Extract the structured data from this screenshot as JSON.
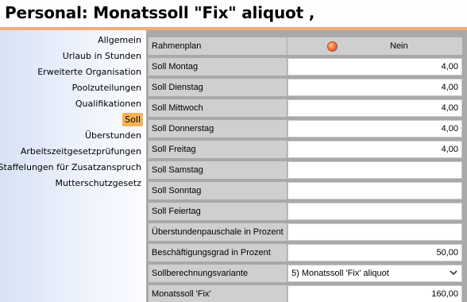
{
  "window": {
    "title": "Personal: Monatssoll \"Fix\" aliquot ,"
  },
  "sidebar": {
    "items": [
      {
        "label": "Allgemein",
        "active": false
      },
      {
        "label": "Urlaub in Stunden",
        "active": false
      },
      {
        "label": "Erweiterte Organisation",
        "active": false
      },
      {
        "label": "Poolzuteilungen",
        "active": false
      },
      {
        "label": "Qualifikationen",
        "active": false
      },
      {
        "label": "Soll",
        "active": true
      },
      {
        "label": "Überstunden",
        "active": false
      },
      {
        "label": "Arbeitszeitgesetzprüfungen",
        "active": false
      },
      {
        "label": "Staffelungen für Zusatzanspruch",
        "active": false
      },
      {
        "label": "Mutterschutzgesetz",
        "active": false
      }
    ]
  },
  "form": {
    "rahmenplan": {
      "label": "Rahmenplan",
      "status_icon": "red-status-dot-icon",
      "value": "Nein"
    },
    "rows": [
      {
        "label": "Soll Montag",
        "value": "4,00"
      },
      {
        "label": "Soll Dienstag",
        "value": "4,00"
      },
      {
        "label": "Soll Mittwoch",
        "value": "4,00"
      },
      {
        "label": "Soll Donnerstag",
        "value": "4,00"
      },
      {
        "label": "Soll Freitag",
        "value": "4,00"
      },
      {
        "label": "Soll Samstag",
        "value": ""
      },
      {
        "label": "Soll Sonntag",
        "value": ""
      },
      {
        "label": "Soll Feiertag",
        "value": ""
      },
      {
        "label": "Überstundenpauschale in Prozent",
        "value": ""
      },
      {
        "label": "Beschäftigungsgrad in Prozent",
        "value": "50,00"
      }
    ],
    "variante": {
      "label": "Sollberechnungsvariante",
      "value": "5) Monatssoll 'Fix' aliquot",
      "icon": "chevron-down-icon"
    },
    "monatssoll": {
      "label": "Monatssoll 'Fix'",
      "value": "160,00"
    }
  },
  "colors": {
    "accent": "#f3b356",
    "panel": "#a9a9a9",
    "label_bg": "#cfcfcf"
  }
}
